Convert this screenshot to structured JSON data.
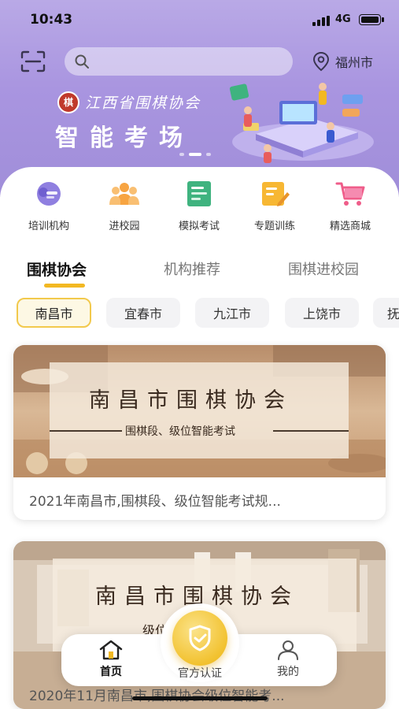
{
  "status_bar": {
    "time": "10:43",
    "network": "4G"
  },
  "header": {
    "search_placeholder": "",
    "location": "福州市"
  },
  "banner": {
    "association_name": "江西省围棋协会",
    "title": "智能考场",
    "slides": 3,
    "active_slide": 2
  },
  "menu": [
    {
      "label": "培训机构",
      "icon": "training-institution-icon"
    },
    {
      "label": "进校园",
      "icon": "campus-group-icon"
    },
    {
      "label": "模拟考试",
      "icon": "mock-exam-icon"
    },
    {
      "label": "专题训练",
      "icon": "topic-training-icon"
    },
    {
      "label": "精选商城",
      "icon": "shopping-cart-icon"
    }
  ],
  "tabs": [
    {
      "label": "围棋协会",
      "active": true
    },
    {
      "label": "机构推荐",
      "active": false
    },
    {
      "label": "围棋进校园",
      "active": false
    }
  ],
  "cities": [
    {
      "label": "南昌市",
      "active": true
    },
    {
      "label": "宜春市",
      "active": false
    },
    {
      "label": "九江市",
      "active": false
    },
    {
      "label": "上饶市",
      "active": false
    },
    {
      "label": "抚",
      "active": false
    }
  ],
  "cards": [
    {
      "image_title": "南昌市围棋协会",
      "image_subtitle": "围棋段、级位智能考试",
      "caption": "2021年南昌市,围棋段、级位智能考试规..."
    },
    {
      "image_title": "南昌市围棋协会",
      "image_subtitle": "级位智能考试",
      "caption": "2020年11月南昌市,围棋协会级位智能考..."
    }
  ],
  "bottom_nav": {
    "home": "首页",
    "certification": "官方认证",
    "mine": "我的"
  },
  "colors": {
    "accent": "#f2b822",
    "hero_purple": "#a995e0",
    "chip_active_border": "#f2c94c"
  }
}
